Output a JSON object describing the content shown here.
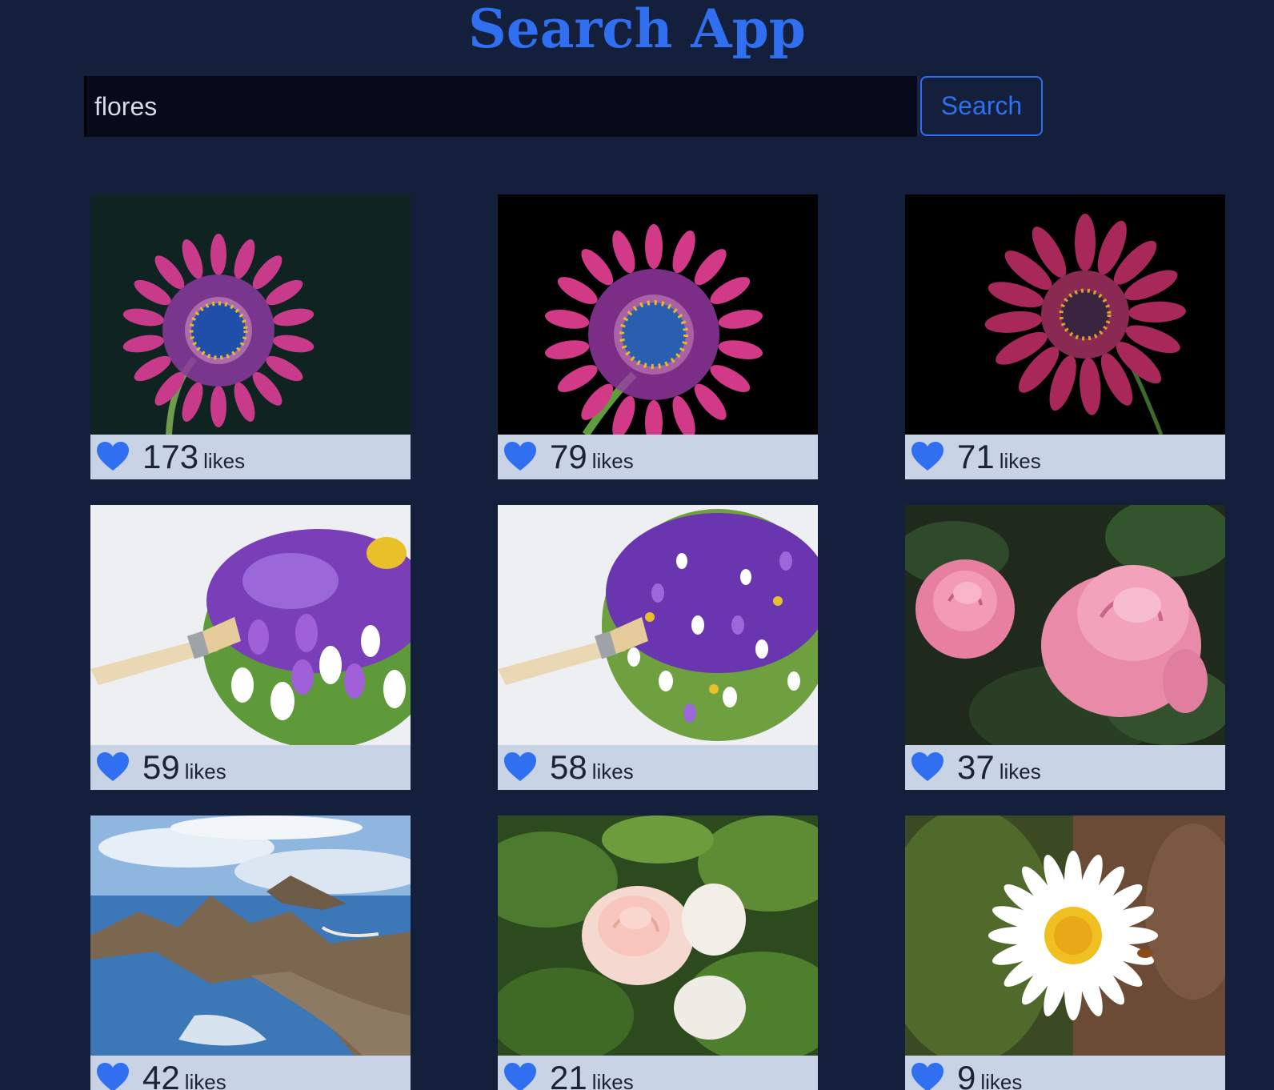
{
  "header": {
    "title": "Search App"
  },
  "search": {
    "value": "flores",
    "placeholder": "",
    "button_label": "Search"
  },
  "colors": {
    "accent": "#2f6ff0",
    "background": "#141f3b",
    "card_footer": "#c8d3e5"
  },
  "results": [
    {
      "likes": "173",
      "likes_label": "likes",
      "subject": "purple-osteospermum-flower"
    },
    {
      "likes": "79",
      "likes_label": "likes",
      "subject": "purple-osteospermum-flower-black-bg"
    },
    {
      "likes": "71",
      "likes_label": "likes",
      "subject": "magenta-osteospermum-flower"
    },
    {
      "likes": "59",
      "likes_label": "likes",
      "subject": "painted-crocus-field"
    },
    {
      "likes": "58",
      "likes_label": "likes",
      "subject": "painted-crocus-meadow"
    },
    {
      "likes": "37",
      "likes_label": "likes",
      "subject": "pink-roses"
    },
    {
      "likes": "42",
      "likes_label": "likes",
      "subject": "island-landscape"
    },
    {
      "likes": "21",
      "likes_label": "likes",
      "subject": "white-roses"
    },
    {
      "likes": "9",
      "likes_label": "likes",
      "subject": "white-daisy"
    }
  ]
}
